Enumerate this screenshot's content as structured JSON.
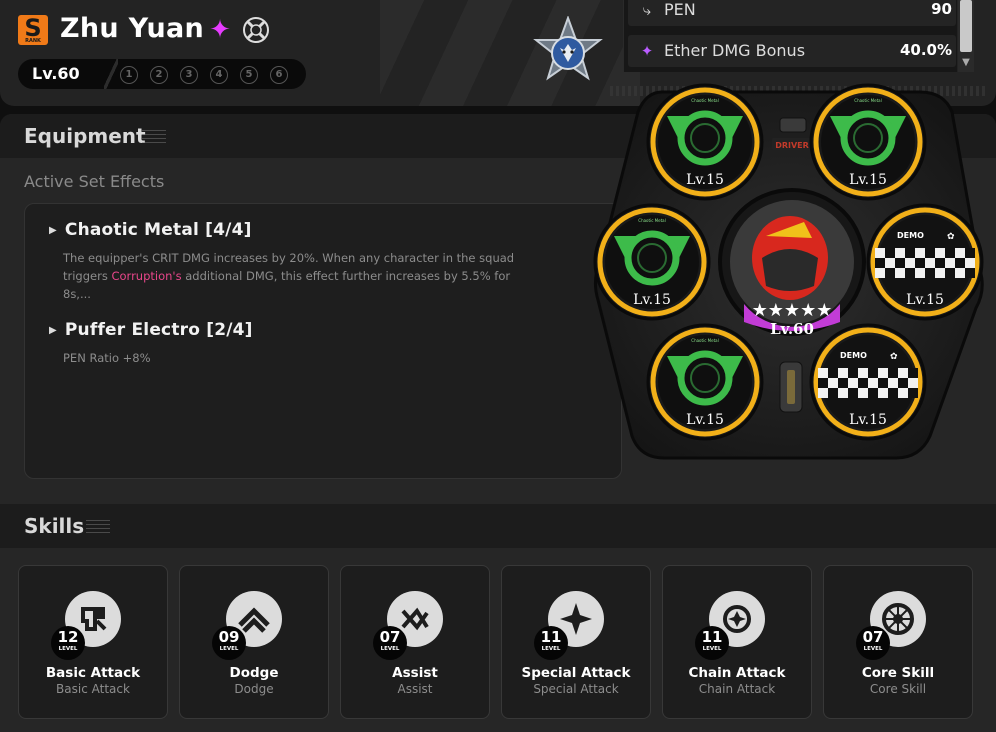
{
  "agent": {
    "rank": "S",
    "rank_caption": "RANK",
    "name": "Zhu Yuan",
    "level": "Lv.60",
    "cinema": [
      "1",
      "2",
      "3",
      "4",
      "5",
      "6"
    ],
    "attribute_icon": "ether-sparkle-icon",
    "specialty_icon": "attack-crossed-swords-icon"
  },
  "stats": [
    {
      "icon": "pen-icon",
      "label": "PEN",
      "value": "90"
    },
    {
      "icon": "ether-sparkle-icon",
      "label": "Ether DMG Bonus",
      "value": "40.0%"
    }
  ],
  "equipment": {
    "title": "Equipment",
    "active_set_label": "Active Set Effects",
    "sets": [
      {
        "name": "Chaotic Metal [4/4]",
        "desc_before": "The equipper's CRIT DMG increases by 20%. When any character in the squad triggers ",
        "desc_highlight": "Corruption's",
        "desc_after": " additional DMG, this effect further increases by 5.5% for 8s,..."
      },
      {
        "name": "Puffer Electro [2/4]",
        "desc": "PEN Ratio +8%"
      }
    ]
  },
  "wheel": {
    "driver_label": "DRIVER",
    "engine_level": "Lv.60",
    "discs": [
      {
        "set": "Chaotic Metal",
        "level": "Lv.15",
        "style": "green"
      },
      {
        "set": "Chaotic Metal",
        "level": "Lv.15",
        "style": "green"
      },
      {
        "set": "DEMO",
        "level": "Lv.15",
        "style": "checker"
      },
      {
        "set": "DEMO",
        "level": "Lv.15",
        "style": "checker"
      },
      {
        "set": "Chaotic Metal",
        "level": "Lv.15",
        "style": "green"
      },
      {
        "set": "Chaotic Metal",
        "level": "Lv.15",
        "style": "green"
      }
    ]
  },
  "skills": {
    "title": "Skills",
    "level_caption": "LEVEL",
    "items": [
      {
        "icon": "basic-attack-icon",
        "level": "12",
        "name": "Basic Attack",
        "sub": "Basic Attack"
      },
      {
        "icon": "dodge-icon",
        "level": "09",
        "name": "Dodge",
        "sub": "Dodge"
      },
      {
        "icon": "assist-icon",
        "level": "07",
        "name": "Assist",
        "sub": "Assist"
      },
      {
        "icon": "special-attack-icon",
        "level": "11",
        "name": "Special Attack",
        "sub": "Special Attack"
      },
      {
        "icon": "chain-attack-icon",
        "level": "11",
        "name": "Chain Attack",
        "sub": "Chain Attack"
      },
      {
        "icon": "core-skill-icon",
        "level": "07",
        "name": "Core Skill",
        "sub": "Core Skill"
      }
    ]
  },
  "colors": {
    "accent_orange": "#f07a18",
    "disc_gold": "#f2b019",
    "disc_green": "#3dbb4a",
    "engine_magenta": "#c23cd6",
    "highlight_pink": "#e8468a"
  }
}
